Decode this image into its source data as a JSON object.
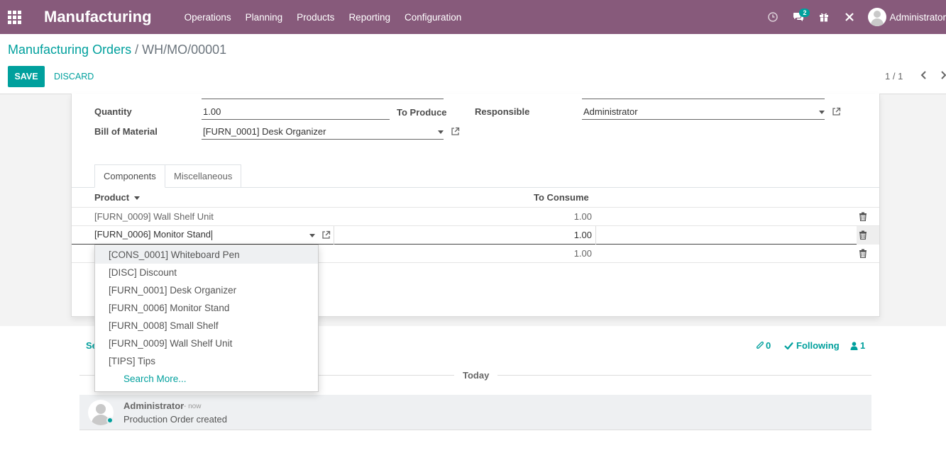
{
  "navbar": {
    "app_title": "Manufacturing",
    "menu": [
      "Operations",
      "Planning",
      "Products",
      "Reporting",
      "Configuration"
    ],
    "messages_badge": "2",
    "user_name": "Administrator"
  },
  "breadcrumb": {
    "parent": "Manufacturing Orders",
    "separator": "/",
    "current": "WH/MO/00001"
  },
  "actions": {
    "save": "SAVE",
    "discard": "DISCARD"
  },
  "pager": {
    "value": "1 / 1"
  },
  "form": {
    "quantity_label": "Quantity",
    "quantity_value": "1.00",
    "to_produce_label": "To Produce",
    "bom_label": "Bill of Material",
    "bom_value": "[FURN_0001] Desk Organizer",
    "responsible_label": "Responsible",
    "responsible_value": "Administrator"
  },
  "tabs": [
    "Components",
    "Miscellaneous"
  ],
  "table": {
    "headers": {
      "product": "Product",
      "to_consume": "To Consume"
    },
    "rows": [
      {
        "product": "[FURN_0009] Wall Shelf Unit",
        "qty": "1.00"
      },
      {
        "product": "[FURN_0006] Monitor Stand",
        "qty": "1.00"
      },
      {
        "product": "",
        "qty": "1.00"
      }
    ]
  },
  "dropdown": {
    "items": [
      "[CONS_0001] Whiteboard Pen",
      "[DISC] Discount",
      "[FURN_0001] Desk Organizer",
      "[FURN_0006] Monitor Stand",
      "[FURN_0008] Small Shelf",
      "[FURN_0009] Wall Shelf Unit",
      "[TIPS] Tips"
    ],
    "search_more": "Search More..."
  },
  "chatter": {
    "send_partial": "Se",
    "attachments": "0",
    "following": "Following",
    "followers": "1",
    "today": "Today",
    "message": {
      "author": "Administrator",
      "time": "- now",
      "body": "Production Order created"
    }
  },
  "colors": {
    "brand": "#875A7B",
    "accent": "#00A09D"
  }
}
